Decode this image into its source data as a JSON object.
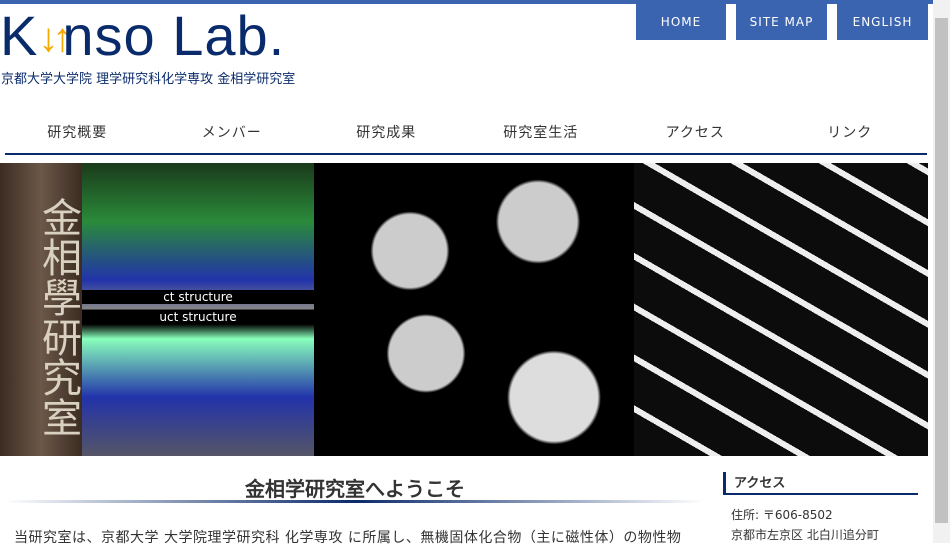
{
  "header": {
    "logo_k": "K",
    "logo_arrows": "↓↑",
    "logo_rest": "nso Lab.",
    "subtitle": "京都大学大学院 理学研究科化学専攻 金相学研究室"
  },
  "topnav": [
    "HOME",
    "SITE MAP",
    "ENGLISH"
  ],
  "menu": [
    "研究概要",
    "メンバー",
    "研究成果",
    "研究室生活",
    "アクセス",
    "リンク"
  ],
  "banner": {
    "calligraphy": "金相學研究室",
    "label1": "ct structure",
    "label2": "uct structure"
  },
  "main": {
    "title": "金相学研究室へようこそ",
    "intro": "当研究室は、京都大学 大学院理学研究科 化学専攻 に所属し、無機固体化合物（主に磁性体）の物性物"
  },
  "sidebar": {
    "heading": "アクセス",
    "address1": "住所: 〒606-8502",
    "address2": "京都市左京区 北白川追分町"
  }
}
